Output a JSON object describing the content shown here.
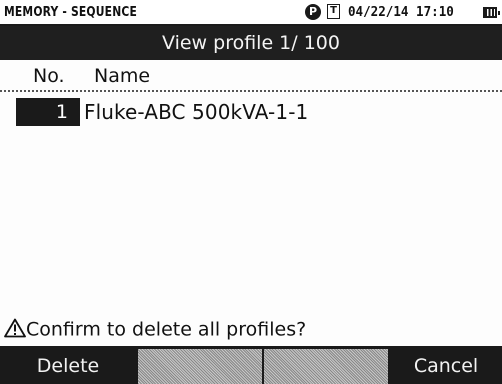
{
  "status": {
    "mode": "MEMORY - SEQUENCE",
    "p_icon_label": "P",
    "t_icon_label": "T",
    "datetime": "04/22/14 17:10",
    "icons": [
      "p-circle-icon",
      "t-box-icon",
      "battery-icon"
    ]
  },
  "title": "View profile 1/ 100",
  "columns": {
    "no": "No.",
    "name": "Name"
  },
  "rows": [
    {
      "no": "1",
      "name": "Fluke-ABC 500kVA-1-1",
      "selected": true
    }
  ],
  "message": {
    "icon": "warning-icon",
    "text": "Confirm to delete all profiles?"
  },
  "softkeys": [
    {
      "label": "Delete",
      "enabled": true
    },
    {
      "label": "",
      "enabled": false
    },
    {
      "label": "",
      "enabled": false
    },
    {
      "label": "Cancel",
      "enabled": true
    }
  ],
  "colors": {
    "bar": "#1a1a1a",
    "text": "#111111",
    "background": "#fdfdfd"
  }
}
